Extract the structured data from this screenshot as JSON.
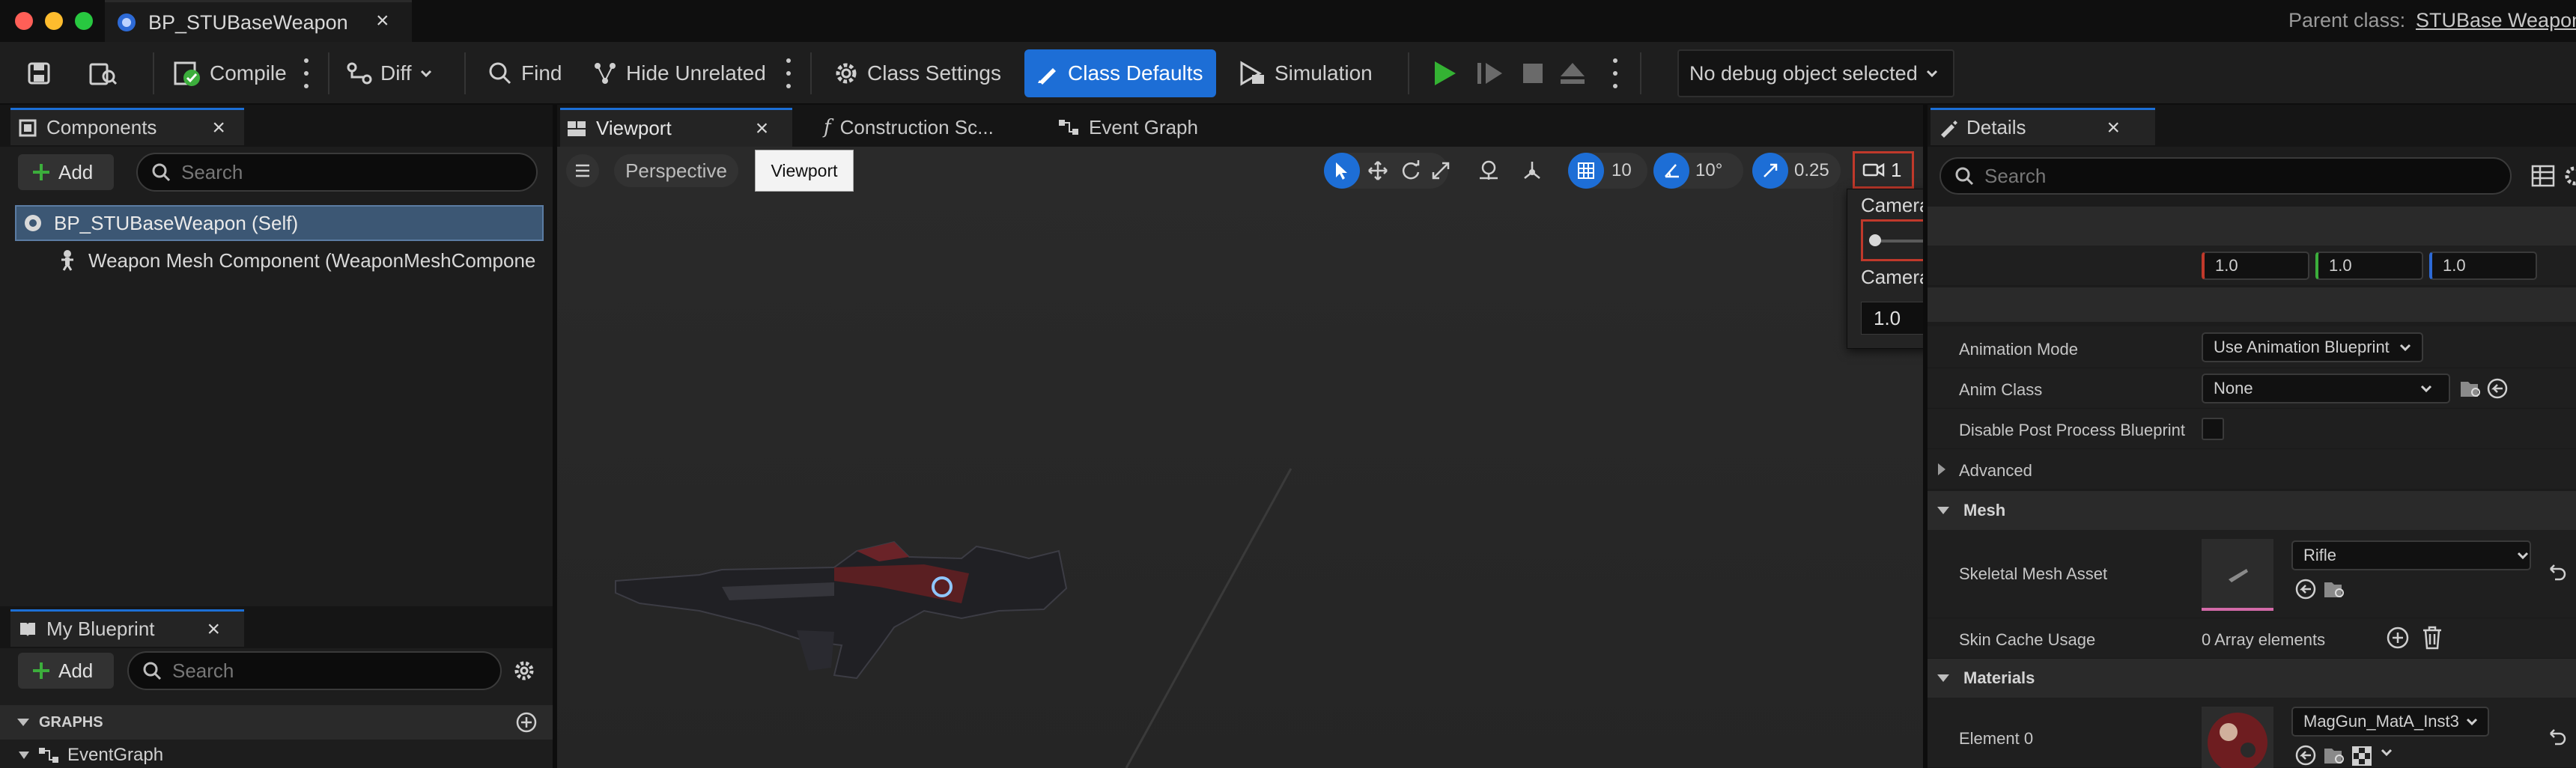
{
  "title_bar": {
    "tab_title": "BP_STUBaseWeapon",
    "parent_class_label": "Parent class:",
    "parent_class_value": "STUBase Weapon"
  },
  "toolbar": {
    "compile": "Compile",
    "diff": "Diff",
    "find": "Find",
    "hide_unrelated": "Hide Unrelated",
    "class_settings": "Class Settings",
    "class_defaults": "Class Defaults",
    "simulation": "Simulation",
    "debug_object": "No debug object selected"
  },
  "components": {
    "tab_label": "Components",
    "add_label": "Add",
    "search_placeholder": "Search",
    "tree": [
      "BP_STUBaseWeapon (Self)",
      "Weapon Mesh Component (WeaponMeshCompone"
    ]
  },
  "my_blueprint": {
    "tab_label": "My Blueprint",
    "add_label": "Add",
    "search_placeholder": "Search",
    "graphs_header": "GRAPHS",
    "graph_item": "EventGraph"
  },
  "editor_tabs": {
    "viewport": "Viewport",
    "construction": "Construction Sc...",
    "event_graph": "Event Graph",
    "tooltip": "Viewport"
  },
  "viewport_toolbar": {
    "perspective": "Perspective",
    "grid_snap": "10",
    "rotation_snap": "10°",
    "scale_snap": "0.25",
    "camera_speed": "1"
  },
  "camera_popup": {
    "speed_label": "Camera Speed",
    "speed_value": "1",
    "speed_level": 0,
    "scalar_label": "Camera Speed Scalar",
    "scalar_value": "1.0"
  },
  "details": {
    "tab_label": "Details",
    "search_placeholder": "Search",
    "vec": [
      "1.0",
      "1.0",
      "1.0"
    ],
    "animation_mode_label": "Animation Mode",
    "animation_mode_value": "Use Animation Blueprint",
    "anim_class_label": "Anim Class",
    "anim_class_value": "None",
    "disable_post_label": "Disable Post Process Blueprint",
    "advanced_label": "Advanced",
    "mesh_section": "Mesh",
    "skeletal_mesh_label": "Skeletal Mesh Asset",
    "skeletal_mesh_value": "Rifle",
    "skin_cache_label": "Skin Cache Usage",
    "skin_cache_value": "0 Array elements",
    "materials_section": "Materials",
    "element0_label": "Element 0",
    "element0_value": "MagGun_MatA_Inst3"
  },
  "colors": {
    "accent_blue": "#1d6ed6",
    "highlight_red": "#c0392b",
    "play_green": "#34b233"
  }
}
